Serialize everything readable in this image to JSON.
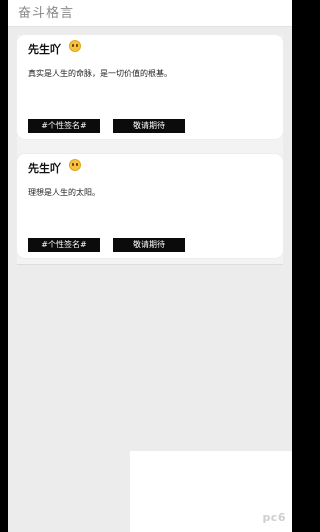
{
  "header": {
    "title": "奋斗格言"
  },
  "cards": [
    {
      "author": "先生吖",
      "emoji": "grinning-face-emoji",
      "quote": "真实是人生的命脉，是一切价值的根基。",
      "tag_label": "#个性签名#",
      "action_label": "敬请期待"
    },
    {
      "author": "先生吖",
      "emoji": "grinning-face-emoji",
      "quote": "理想是人生的太阳。",
      "tag_label": "#个性签名#",
      "action_label": "敬请期待"
    }
  ],
  "watermark": "pc6"
}
